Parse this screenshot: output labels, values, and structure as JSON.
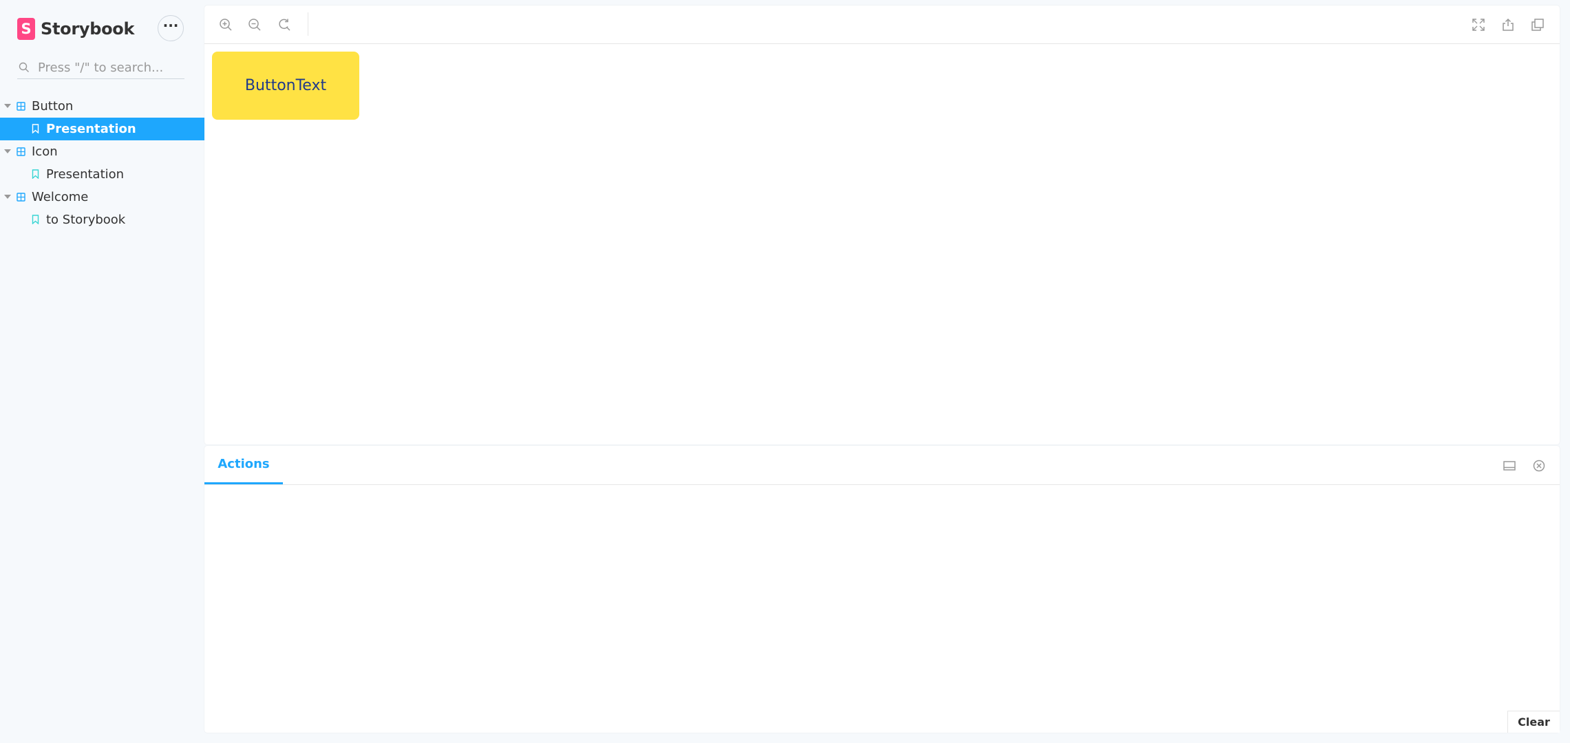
{
  "app": {
    "name": "Storybook",
    "logo_letter": "S",
    "brand_color": "#ff4785",
    "accent_color": "#1ea7fd"
  },
  "sidebar": {
    "menu_icon": "ellipsis-icon",
    "search": {
      "placeholder": "Press \"/\" to search...",
      "value": ""
    },
    "tree": [
      {
        "label": "Button",
        "stories": [
          {
            "label": "Presentation",
            "active": true
          }
        ]
      },
      {
        "label": "Icon",
        "stories": [
          {
            "label": "Presentation",
            "active": false
          }
        ]
      },
      {
        "label": "Welcome",
        "stories": [
          {
            "label": "to Storybook",
            "active": false
          }
        ]
      }
    ]
  },
  "toolbar": {
    "left_tools": [
      "zoom-in-icon",
      "zoom-out-icon",
      "reset-zoom-icon"
    ],
    "right_tools": [
      "fullscreen-icon",
      "share-icon",
      "open-new-tab-icon"
    ]
  },
  "preview": {
    "button_text": "ButtonText",
    "button_color": "#ffe244",
    "button_text_color": "#1f3a8a"
  },
  "addons": {
    "tabs": [
      {
        "label": "Actions",
        "active": true
      }
    ],
    "icons": [
      "panel-position-icon",
      "close-panel-icon"
    ],
    "clear_label": "Clear"
  }
}
